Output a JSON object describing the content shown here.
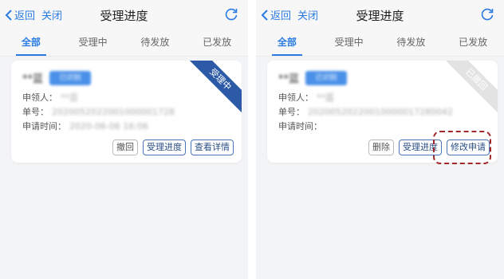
{
  "left": {
    "nav": {
      "back_label": "返回",
      "close_label": "关闭",
      "title": "受理进度"
    },
    "tabs": [
      "全部",
      "受理中",
      "待发放",
      "已发放"
    ],
    "card": {
      "name": "**蓝",
      "tag": "已识别",
      "applicant_label": "申领人：",
      "applicant_value": "**芸",
      "order_label": "单号：",
      "order_value": "2020052022001000001728",
      "time_label": "申请时间：",
      "time_value": "2020-06-06 16:06",
      "status": "受理中",
      "buttons": [
        "撤回",
        "受理进度",
        "查看详情"
      ]
    }
  },
  "right": {
    "nav": {
      "back_label": "返回",
      "close_label": "关闭",
      "title": "受理进度"
    },
    "tabs": [
      "全部",
      "受理中",
      "待发放",
      "已发放"
    ],
    "card": {
      "name": "**蓝",
      "tag": "已识别",
      "applicant_label": "申领人：",
      "applicant_value": "**蓝",
      "order_label": "单号：",
      "order_value": "20200520220010000017280042",
      "time_label": "申请时间：",
      "status": "已撤回",
      "buttons": [
        "删除",
        "受理进度",
        "修改申请"
      ]
    }
  },
  "colors": {
    "accent": "#2a7be4",
    "ribbon_active": "#2d5aa6",
    "ribbon_withdrawn": "#e3e3e3",
    "highlight": "#a0282a"
  },
  "icons": [
    "chevron-left-icon",
    "refresh-icon"
  ]
}
